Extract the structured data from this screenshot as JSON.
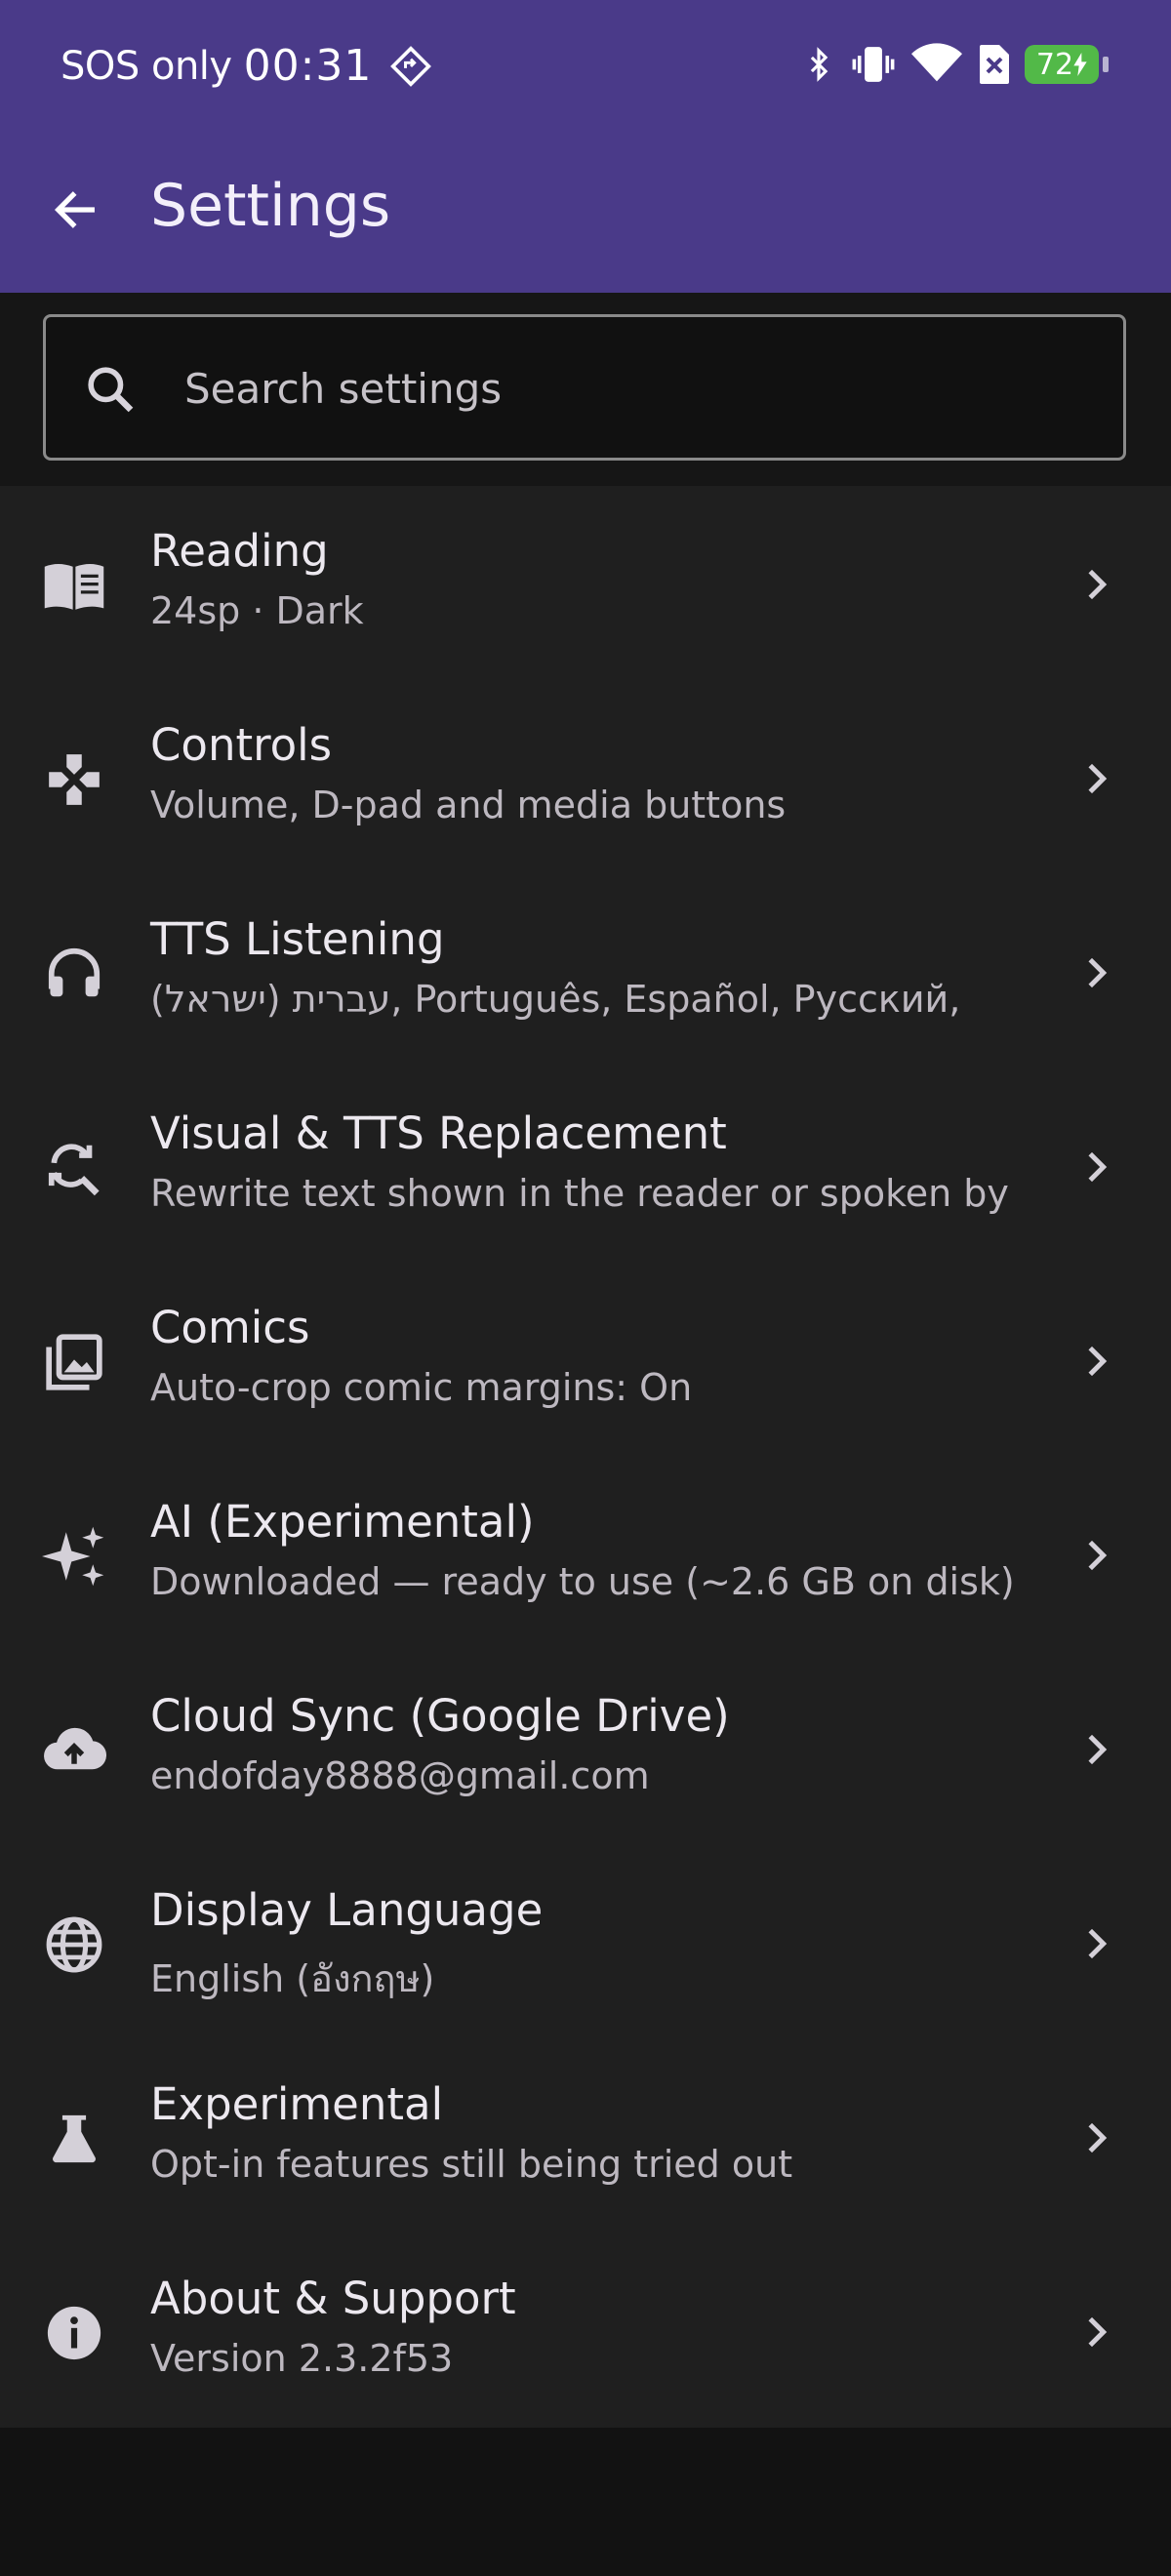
{
  "status_bar": {
    "carrier": "SOS only",
    "time": "00:31",
    "battery_level": "72"
  },
  "app_bar": {
    "title": "Settings",
    "back_icon": "arrow-back-icon"
  },
  "search": {
    "placeholder": "Search settings",
    "icon": "search-icon"
  },
  "settings_items": [
    {
      "label": "Reading",
      "sub": "24sp · Dark",
      "icon": "book-icon"
    },
    {
      "label": "Controls",
      "sub": "Volume, D-pad and media buttons",
      "icon": "gamepad-icon"
    },
    {
      "label": "TTS Listening",
      "sub": "(ישראל) עברית, Português, Español, Русский,",
      "icon": "headphones-icon"
    },
    {
      "label": "Visual & TTS Replacement",
      "sub": "Rewrite text shown in the reader or spoken by",
      "icon": "find-replace-icon"
    },
    {
      "label": "Comics",
      "sub": "Auto-crop comic margins: On",
      "icon": "photo-library-icon"
    },
    {
      "label": "AI (Experimental)",
      "sub": "Downloaded — ready to use (~2.6 GB on disk)",
      "icon": "sparkles-icon"
    },
    {
      "label": "Cloud Sync (Google Drive)",
      "sub": "endofday8888@gmail.com",
      "icon": "cloud-upload-icon"
    },
    {
      "label": "Display Language",
      "sub": "English (อังกฤษ)",
      "icon": "globe-icon"
    },
    {
      "label": "Experimental",
      "sub": "Opt-in features still being tried out",
      "icon": "flask-icon"
    },
    {
      "label": "About & Support",
      "sub": "Version 2.3.2f53",
      "icon": "info-icon"
    }
  ],
  "colors": {
    "app_bar": "#4a3a89",
    "background": "#121212",
    "list_background": "#1f1f1f",
    "battery": "#52b948"
  }
}
